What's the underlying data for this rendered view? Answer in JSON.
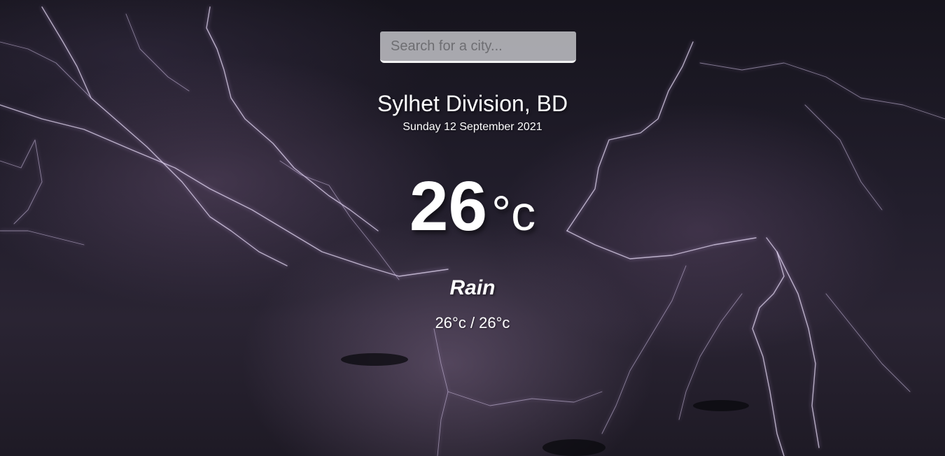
{
  "search": {
    "placeholder": "Search for a city...",
    "value": ""
  },
  "location": {
    "name": "Sylhet Division, BD",
    "date": "Sunday 12 September 2021"
  },
  "current": {
    "temperature": "26",
    "unit": "°c",
    "condition": "Rain",
    "hi_low": "26°c / 26°c"
  },
  "colors": {
    "text": "#ffffff",
    "search_bg": "#c8c8cd",
    "background": "#1d1a26"
  }
}
